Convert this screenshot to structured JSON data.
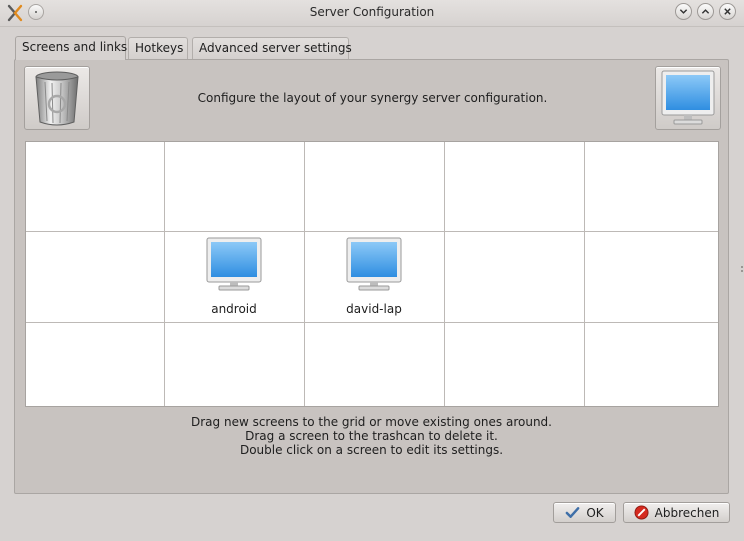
{
  "window": {
    "title": "Server Configuration"
  },
  "tabs": [
    {
      "label": "Screens and links",
      "active": true
    },
    {
      "label": "Hotkeys",
      "active": false
    },
    {
      "label": "Advanced server settings",
      "active": false
    }
  ],
  "screens_tab": {
    "heading": "Configure the layout of your synergy server configuration.",
    "grid": {
      "columns": 5,
      "rows": 3,
      "screens": [
        {
          "name": "android",
          "row": 2,
          "column": 2
        },
        {
          "name": "david-lap",
          "row": 2,
          "column": 3
        }
      ]
    },
    "hint_lines": [
      "Drag new screens to the grid or move existing ones around.",
      "Drag a screen to the trashcan to delete it.",
      "Double click on a screen to edit its settings."
    ]
  },
  "buttons": {
    "ok": "OK",
    "cancel": "Abbrechen"
  },
  "icons": {
    "app": "synergy-x-icon",
    "trash": "trash-can-icon",
    "new_screen": "monitor-icon",
    "ok": "checkmark-icon",
    "cancel": "cancel-icon"
  },
  "colors": {
    "window_bg": "#d6d2d0",
    "grid_bg": "#ffffff",
    "monitor_screen": "#3d9bea",
    "cancel_red": "#d52a1f"
  }
}
